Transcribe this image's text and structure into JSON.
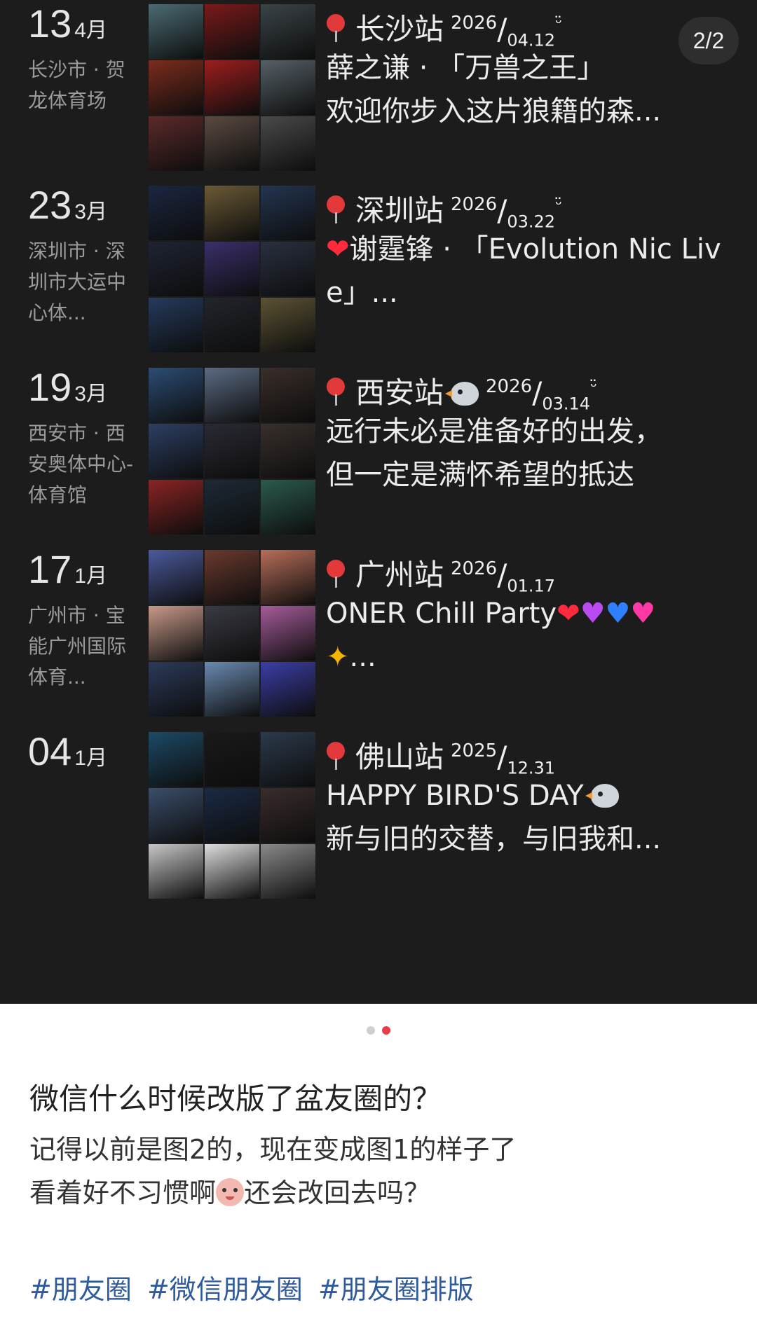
{
  "page_indicator": "2/2",
  "entries": [
    {
      "day": "13",
      "month": "4月",
      "location": "长沙市 · 贺龙体育场",
      "place": "长沙站",
      "year": "2026",
      "md": "04.12",
      "smile": "ᵕ̈",
      "caption": "薛之谦 · 「万兽之王」\n欢迎你步入这片狼籍的森...",
      "thumbs": [
        "#4b6b73",
        "#7a1a1a",
        "#3b4448",
        "#7b2c1d",
        "#9c1e1e",
        "#556066",
        "#5c2a2a",
        "#5b4a42",
        "#4a4a4a"
      ]
    },
    {
      "day": "23",
      "month": "3月",
      "location": "深圳市 · 深圳市大运中心体...",
      "place": "深圳站",
      "year": "2026",
      "md": "03.22",
      "smile": "ᵕ̈",
      "caption": "谢霆锋 · 「Evolution Nic Live」...",
      "thumbs": [
        "#1b2640",
        "#6b5a36",
        "#233550",
        "#1f2433",
        "#3b2f6b",
        "#2a3040",
        "#253a5c",
        "#22252c",
        "#5c5334"
      ]
    },
    {
      "day": "19",
      "month": "3月",
      "location": "西安市 · 西安奥体中心-体育馆",
      "place": "西安站",
      "year": "2026",
      "md": "03.14",
      "smile": "ᵕ̈",
      "caption": "远行未必是准备好的出发，\n但一定是满怀希望的抵达",
      "thumbs": [
        "#2c4c74",
        "#5b6b84",
        "#3a2e2a",
        "#2d3f63",
        "#2a2a34",
        "#38302c",
        "#8a2424",
        "#1d2a36",
        "#2b5a4e"
      ]
    },
    {
      "day": "17",
      "month": "1月",
      "location": "广州市 · 宝能广州国际体育...",
      "place": "广州站",
      "year": "2026",
      "md": "01.17",
      "smile": "",
      "caption": "ONER Chill Party",
      "thumbs": [
        "#4b5a9c",
        "#6a3a2e",
        "#b86e5a",
        "#c89a8a",
        "#3a3a44",
        "#a65c9a",
        "#2c3a5a",
        "#6a8ab0",
        "#3b3ea6"
      ]
    },
    {
      "day": "04",
      "month": "1月",
      "location": "",
      "place": "佛山站",
      "year": "2025",
      "md": "12.31",
      "smile": "",
      "caption": "HAPPY BIRD'S DAY\n新与旧的交替，与旧我和...",
      "thumbs": [
        "#1d4a66",
        "#1a1a1a",
        "#2c3a4c",
        "#3a4e6a",
        "#1a2a44",
        "#3a2c2c",
        "#c7c7c7",
        "#dedede",
        "#8a8a8a"
      ]
    }
  ],
  "emoji": {
    "heart": "❤",
    "purple_heart": "♥",
    "blue_heart": "♥",
    "pink_heart": "♥",
    "party": "✦",
    "ellipsis": "..."
  },
  "post": {
    "title": "微信什么时候改版了盆友圈的？",
    "body_line1": "记得以前是图2的，现在变成图1的样子了",
    "body_line2_a": "看着好不习惯啊",
    "body_line2_b": "还会改回去吗？",
    "tags": [
      "#朋友圈",
      "#微信朋友圈",
      "#朋友圈排版"
    ]
  }
}
